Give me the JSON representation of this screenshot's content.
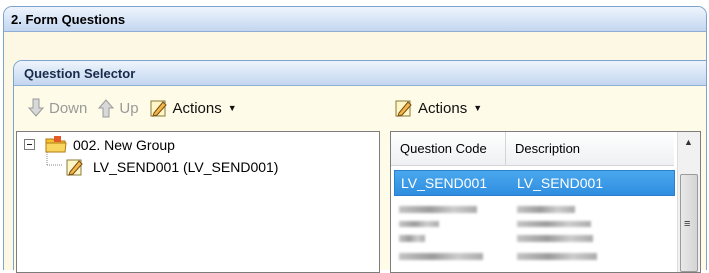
{
  "outer_panel": {
    "title": "2. Form Questions"
  },
  "question_selector": {
    "title": "Question Selector"
  },
  "left_toolbar": {
    "down_label": "Down",
    "up_label": "Up",
    "actions_label": "Actions"
  },
  "right_toolbar": {
    "actions_label": "Actions"
  },
  "tree": {
    "group_label": "002. New Group",
    "child_label": "LV_SEND001 (LV_SEND001)"
  },
  "question_list": {
    "columns": [
      "Question Code",
      "Description"
    ],
    "selected_row": {
      "code": "LV_SEND001",
      "description": "LV_SEND001"
    }
  },
  "colors": {
    "selection": "#3a98e8",
    "panel_border": "#7ea3cf",
    "panel_bg": "#fdf8e4"
  },
  "icons": [
    "arrow-down-icon",
    "arrow-up-icon",
    "pencil-edit-icon",
    "folder-icon",
    "document-edit-icon",
    "expand-collapse-icon"
  ]
}
